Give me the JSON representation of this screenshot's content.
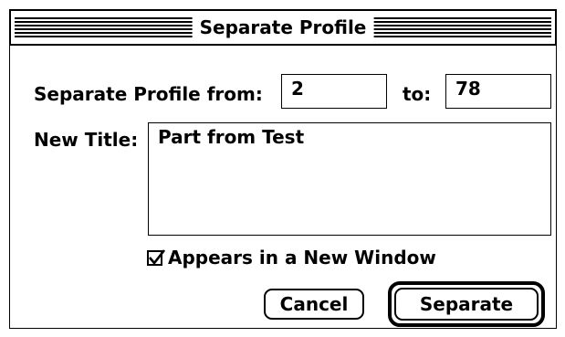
{
  "window": {
    "title": "Separate Profile"
  },
  "range": {
    "from_label": "Separate Profile from:",
    "from_value": "2",
    "to_label": "to:",
    "to_value": "78"
  },
  "new_title": {
    "label": "New Title:",
    "value": "Part from Test"
  },
  "new_window_checkbox": {
    "label": "Appears in a New Window",
    "checked": true
  },
  "buttons": {
    "cancel_label": "Cancel",
    "separate_label": "Separate"
  },
  "icons": {
    "checkbox_mark": "checkmark-icon"
  }
}
